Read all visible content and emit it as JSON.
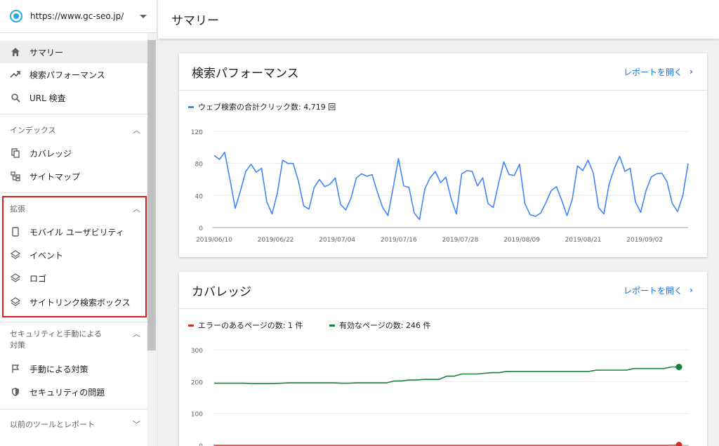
{
  "property": {
    "url": "https://www.gc-seo.jp/"
  },
  "header": {
    "title": "サマリー"
  },
  "sidebar": {
    "items": [
      {
        "label": "サマリー"
      },
      {
        "label": "検索パフォーマンス"
      },
      {
        "label": "URL 検査"
      }
    ],
    "index_section": {
      "title": "インデックス",
      "items": [
        {
          "label": "カバレッジ"
        },
        {
          "label": "サイトマップ"
        }
      ]
    },
    "enhance_section": {
      "title": "拡張",
      "items": [
        {
          "label": "モバイル ユーザビリティ"
        },
        {
          "label": "イベント"
        },
        {
          "label": "ロゴ"
        },
        {
          "label": "サイトリンク検索ボックス"
        }
      ]
    },
    "security_section": {
      "title": "セキュリティと手動による対策",
      "items": [
        {
          "label": "手動による対策"
        },
        {
          "label": "セキュリティの問題"
        }
      ]
    },
    "legacy_section": {
      "title": "以前のツールとレポート"
    }
  },
  "performance_card": {
    "title": "検索パフォーマンス",
    "link": "レポートを開く",
    "legend": "ウェブ検索の合計クリック数: 4,719 回"
  },
  "coverage_card": {
    "title": "カバレッジ",
    "link": "レポートを開く",
    "legend_error": "エラーのあるページの数: 1 件",
    "legend_valid": "有効なページの数: 246 件"
  },
  "colors": {
    "accent": "#1a73e8",
    "line_blue": "#4285f4",
    "error": "#d93025",
    "valid": "#188038",
    "highlight": "#e01b1b"
  },
  "chart_data": [
    {
      "type": "line",
      "title": "検索パフォーマンス",
      "ylim": [
        0,
        120
      ],
      "yticks": [
        0,
        40,
        80,
        120
      ],
      "xticks": [
        "2019/06/10",
        "2019/06/22",
        "2019/07/04",
        "2019/07/16",
        "2019/07/28",
        "2019/08/09",
        "2019/08/21",
        "2019/09/02"
      ],
      "series": [
        {
          "name": "ウェブ検索の合計クリック数",
          "values": [
            90,
            85,
            94,
            60,
            24,
            46,
            70,
            79,
            69,
            74,
            32,
            17,
            43,
            84,
            80,
            80,
            58,
            27,
            23,
            50,
            60,
            51,
            54,
            62,
            29,
            22,
            37,
            62,
            67,
            64,
            66,
            44,
            25,
            15,
            50,
            86,
            52,
            50,
            18,
            10,
            48,
            62,
            70,
            56,
            63,
            36,
            17,
            67,
            71,
            70,
            52,
            62,
            30,
            25,
            55,
            82,
            66,
            65,
            79,
            30,
            16,
            14,
            18,
            31,
            46,
            51,
            34,
            15,
            35,
            77,
            71,
            84,
            68,
            25,
            17,
            54,
            74,
            89,
            70,
            74,
            32,
            19,
            46,
            63,
            67,
            68,
            57,
            30,
            20,
            40,
            80
          ]
        }
      ]
    },
    {
      "type": "line",
      "title": "カバレッジ",
      "ylim": [
        0,
        300
      ],
      "yticks": [
        0,
        100,
        200,
        300
      ],
      "series": [
        {
          "name": "有効なページの数",
          "values": [
            195,
            195,
            195,
            195,
            195,
            194,
            194,
            194,
            194,
            195,
            196,
            196,
            196,
            196,
            196,
            196,
            196,
            195,
            195,
            196,
            196,
            196,
            196,
            196,
            202,
            202,
            205,
            205,
            207,
            207,
            207,
            217,
            217,
            224,
            224,
            224,
            226,
            228,
            228,
            232,
            232,
            232,
            232,
            232,
            232,
            232,
            232,
            232,
            232,
            232,
            232,
            236,
            236,
            236,
            236,
            236,
            241,
            241,
            241,
            241,
            241,
            246,
            246
          ]
        },
        {
          "name": "エラーのあるページの数",
          "values": [
            0,
            0,
            0,
            0,
            0,
            0,
            0,
            0,
            0,
            0,
            0,
            0,
            0,
            0,
            0,
            0,
            0,
            0,
            0,
            0,
            0,
            0,
            0,
            0,
            0,
            0,
            0,
            0,
            0,
            0,
            0,
            0,
            0,
            0,
            0,
            0,
            0,
            0,
            0,
            0,
            0,
            0,
            0,
            0,
            0,
            0,
            0,
            0,
            0,
            0,
            0,
            0,
            0,
            0,
            0,
            0,
            0,
            0,
            0,
            0,
            0,
            0,
            1
          ]
        }
      ]
    }
  ]
}
